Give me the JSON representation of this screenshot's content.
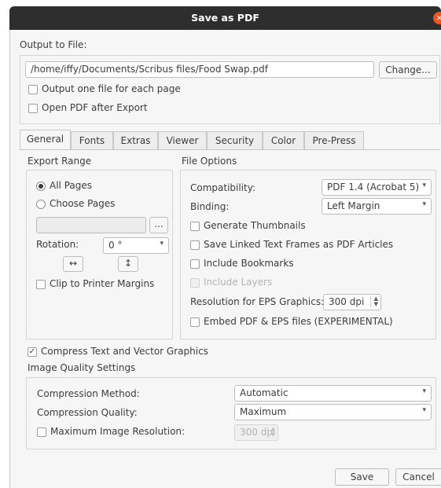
{
  "window": {
    "title": "Save as PDF"
  },
  "output": {
    "label": "Output to File:",
    "path": "/home/iffy/Documents/Scribus files/Food Swap.pdf",
    "change_button": "Change...",
    "one_file_per_page": {
      "label": "Output one file for each page",
      "checked": false
    },
    "open_after_export": {
      "label": "Open PDF after Export",
      "checked": false
    }
  },
  "tabs": [
    {
      "label": "General",
      "active": true
    },
    {
      "label": "Fonts"
    },
    {
      "label": "Extras"
    },
    {
      "label": "Viewer"
    },
    {
      "label": "Security"
    },
    {
      "label": "Color"
    },
    {
      "label": "Pre-Press"
    }
  ],
  "export_range": {
    "heading": "Export Range",
    "all_pages": {
      "label": "All Pages",
      "selected": true
    },
    "choose_pages": {
      "label": "Choose Pages",
      "selected": false
    },
    "pages_value": "",
    "browse_label": "...",
    "rotation_label": "Rotation:",
    "rotation_value": "0 °",
    "flip_horizontal_glyph": "↔",
    "flip_vertical_glyph": "↕",
    "clip_to_margins": {
      "label": "Clip to Printer Margins",
      "checked": false
    }
  },
  "file_options": {
    "heading": "File Options",
    "compatibility_label": "Compatibility:",
    "compatibility_value": "PDF 1.4 (Acrobat 5)",
    "binding_label": "Binding:",
    "binding_value": "Left Margin",
    "generate_thumbnails": {
      "label": "Generate Thumbnails",
      "checked": false
    },
    "save_linked_text_frames": {
      "label": "Save Linked Text Frames as PDF Articles",
      "checked": false
    },
    "include_bookmarks": {
      "label": "Include Bookmarks",
      "checked": false
    },
    "include_layers": {
      "label": "Include Layers",
      "checked": false,
      "disabled": true
    },
    "resolution_label": "Resolution for EPS Graphics:",
    "resolution_value": "300 dpi",
    "embed_pdf_eps": {
      "label": "Embed PDF & EPS files (EXPERIMENTAL)",
      "checked": false
    }
  },
  "compress_text": {
    "label": "Compress Text and Vector Graphics",
    "checked": true,
    "mark": "✓"
  },
  "image_quality": {
    "heading": "Image Quality Settings",
    "method_label": "Compression Method:",
    "method_value": "Automatic",
    "quality_label": "Compression Quality:",
    "quality_value": "Maximum",
    "max_resolution": {
      "label": "Maximum Image Resolution:",
      "checked": false
    },
    "max_resolution_value": "300 dpi"
  },
  "buttons": {
    "save": "Save",
    "cancel": "Cancel"
  },
  "glyphs": {
    "combo_arrow": "▾",
    "spin_up": "▲",
    "spin_down": "▼",
    "close": "×"
  },
  "icons": {
    "close": "close-icon",
    "combo": "chevron-down-icon",
    "spin": "spin-arrows-icon",
    "flip_h": "flip-horizontal-icon",
    "flip_v": "flip-vertical-icon",
    "check": "checkmark-icon"
  },
  "colors": {
    "titlebar": "#2e2e2e",
    "close_button": "#e95420",
    "dialog_bg": "#f6f6f6"
  }
}
